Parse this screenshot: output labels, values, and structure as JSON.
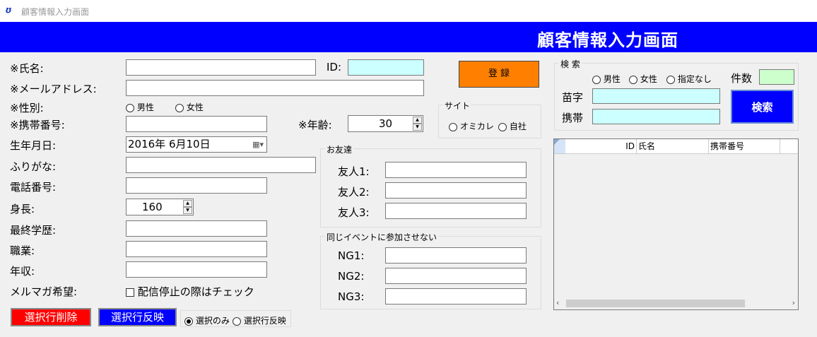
{
  "window": {
    "title": "顧客情報入力画面",
    "icon_glyph": "ʊ"
  },
  "banner": {
    "title": "顧客情報入力画面"
  },
  "form": {
    "name_label": "※氏名:",
    "id_label": "ID:",
    "email_label": "※メールアドレス:",
    "gender_label": "※性別:",
    "gender_male": "男性",
    "gender_female": "女性",
    "mobile_label": "※携帯番号:",
    "age_label": "※年齢:",
    "age_value": "30",
    "birth_label": "生年月日:",
    "birth_value": "2016年  6月10日",
    "furigana_label": "ふりがな:",
    "phone_label": "電話番号:",
    "height_label": "身長:",
    "height_value": "160",
    "education_label": "最終学歴:",
    "job_label": "職業:",
    "income_label": "年収:",
    "newsletter_label": "メルマガ希望:",
    "newsletter_check": "配信停止の際はチェック"
  },
  "register_button": "登 録",
  "site": {
    "title": "サイト",
    "opt1": "オミカレ",
    "opt2": "自社"
  },
  "friends": {
    "title": "お友達",
    "f1": "友人1:",
    "f2": "友人2:",
    "f3": "友人3:"
  },
  "ng": {
    "title": "同じイベントに参加させない",
    "n1": "NG1:",
    "n2": "NG2:",
    "n3": "NG3:"
  },
  "search": {
    "title": "検 索",
    "male": "男性",
    "female": "女性",
    "unspecified": "指定なし",
    "count_label": "件数",
    "surname_label": "苗字",
    "mobile_label": "携帯",
    "search_button": "検索"
  },
  "grid": {
    "columns": [
      "ID",
      "氏名",
      "携帯番号"
    ]
  },
  "bottom": {
    "delete_button": "選択行削除",
    "reflect_button": "選択行反映",
    "opt_select_only": "選択のみ",
    "opt_select_reflect": "選択行反映"
  },
  "colors": {
    "banner": "#0000ff",
    "register": "#ff8000",
    "delete": "#ff0000",
    "reflect": "#0000ff",
    "cyan_field": "#ccffff",
    "count_field": "#ccffcc"
  }
}
